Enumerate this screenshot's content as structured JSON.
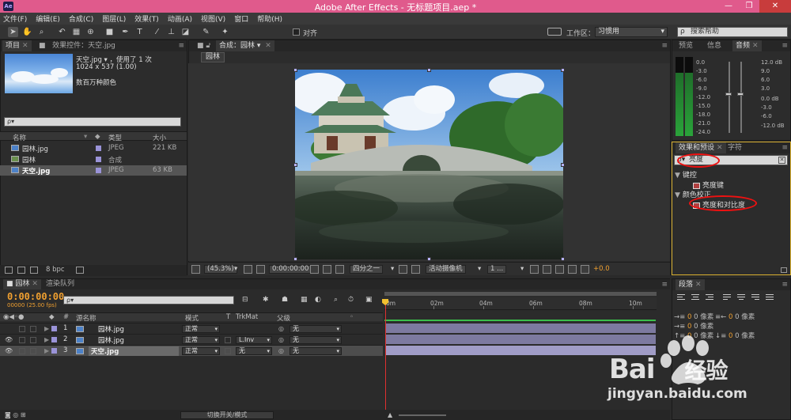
{
  "window": {
    "title": "Adobe After Effects - 无标题项目.aep *",
    "logo": "Ae",
    "buttons": [
      "—",
      "❐",
      "✕"
    ]
  },
  "menu": [
    "文件(F)",
    "编辑(E)",
    "合成(C)",
    "图层(L)",
    "效果(T)",
    "动画(A)",
    "视图(V)",
    "窗口",
    "帮助(H)"
  ],
  "toolbar": {
    "tools": [
      "selection-tool-icon",
      "hand-tool-icon",
      "zoom-tool-icon",
      "rotate-tool-icon",
      "camera-tool-icon",
      "pan-behind-icon",
      "rectangle-tool-icon",
      "pen-tool-icon",
      "text-tool-icon",
      "brush-tool-icon",
      "clone-stamp-icon",
      "eraser-icon",
      "roto-brush-icon",
      "puppet-pin-icon"
    ],
    "snap_label": "对齐",
    "workspace_label": "工作区：",
    "workspace_value": "习惯用",
    "help_search": "搜索帮助"
  },
  "project": {
    "tab_label": "项目",
    "effects_tab": "效果控件：天空.jpg",
    "selected_name": "天空.jpg ▾ ，使用了 1 次",
    "selected_dims": "1024 x 537 (1.00)",
    "selected_color": "数百万种颜色",
    "search_placeholder": "ρ▾",
    "columns": {
      "name": "名称",
      "type": "类型",
      "size": "大小"
    },
    "items": [
      {
        "name": "园林.jpg",
        "type": "JPEG",
        "size": "221 KB",
        "kind": "image"
      },
      {
        "name": "园林",
        "type": "合成",
        "size": "",
        "kind": "comp"
      },
      {
        "name": "天空.jpg",
        "type": "JPEG",
        "size": "63 KB",
        "kind": "image"
      }
    ],
    "bpc": "8 bpc"
  },
  "composition": {
    "tab_label": "合成：园林",
    "sub_tab": "园林",
    "zoom": "(45.3%)",
    "timecode": "0:00:00:00",
    "resolution": "四分之一",
    "camera": "活动摄像机",
    "views": "1 ...",
    "exposure": "+0.0"
  },
  "audio": {
    "tabs": [
      "预览",
      "信息",
      "音频"
    ],
    "left_scale": [
      "0.0",
      "-3.0",
      "-6.0",
      "-9.0",
      "-12.0",
      "-15.0",
      "-18.0",
      "-21.0",
      "-24.0"
    ],
    "right_scale": [
      "12.0 dB",
      "9.0",
      "6.0",
      "3.0",
      "0.0 dB",
      "-3.0",
      "-6.0",
      "-12.0 dB"
    ]
  },
  "effects": {
    "tabs": [
      "效果和预设",
      "字符"
    ],
    "search_value": "亮度",
    "groups": [
      {
        "name": "键控",
        "items": [
          "亮度键"
        ]
      },
      {
        "name": "颜色校正",
        "items": [
          "亮度和对比度"
        ]
      }
    ]
  },
  "paragraph": {
    "tab_label": "段落",
    "values": [
      "0 像素",
      "0 像素",
      "0 像素",
      "0 像素",
      "0 像素"
    ]
  },
  "timeline": {
    "tab_label": "园林",
    "render_tab": "渲染队列",
    "timecode": "0:00:00:00",
    "fps": "00000 (25.00 fps)",
    "columns": {
      "num": "#",
      "source": "源名称",
      "mode": "模式",
      "t": "T",
      "trkmat": "TrkMat",
      "parent": "父级"
    },
    "layers": [
      {
        "num": "1",
        "name": "园林.jpg",
        "mode": "正常",
        "trkmat": "",
        "parent": "无"
      },
      {
        "num": "2",
        "name": "园林.jpg",
        "mode": "正常",
        "trkmat": "L.Inv",
        "parent": "无"
      },
      {
        "num": "3",
        "name": "天空.jpg",
        "mode": "正常",
        "trkmat": "无",
        "parent": "无"
      }
    ],
    "ruler": [
      "0m",
      "02m",
      "04m",
      "06m",
      "08m",
      "10m"
    ],
    "toggle_label": "切换开关/模式"
  },
  "watermark": {
    "brand": "Bai",
    "brand_cn": "经验",
    "site": "jingyan.baidu.com"
  }
}
